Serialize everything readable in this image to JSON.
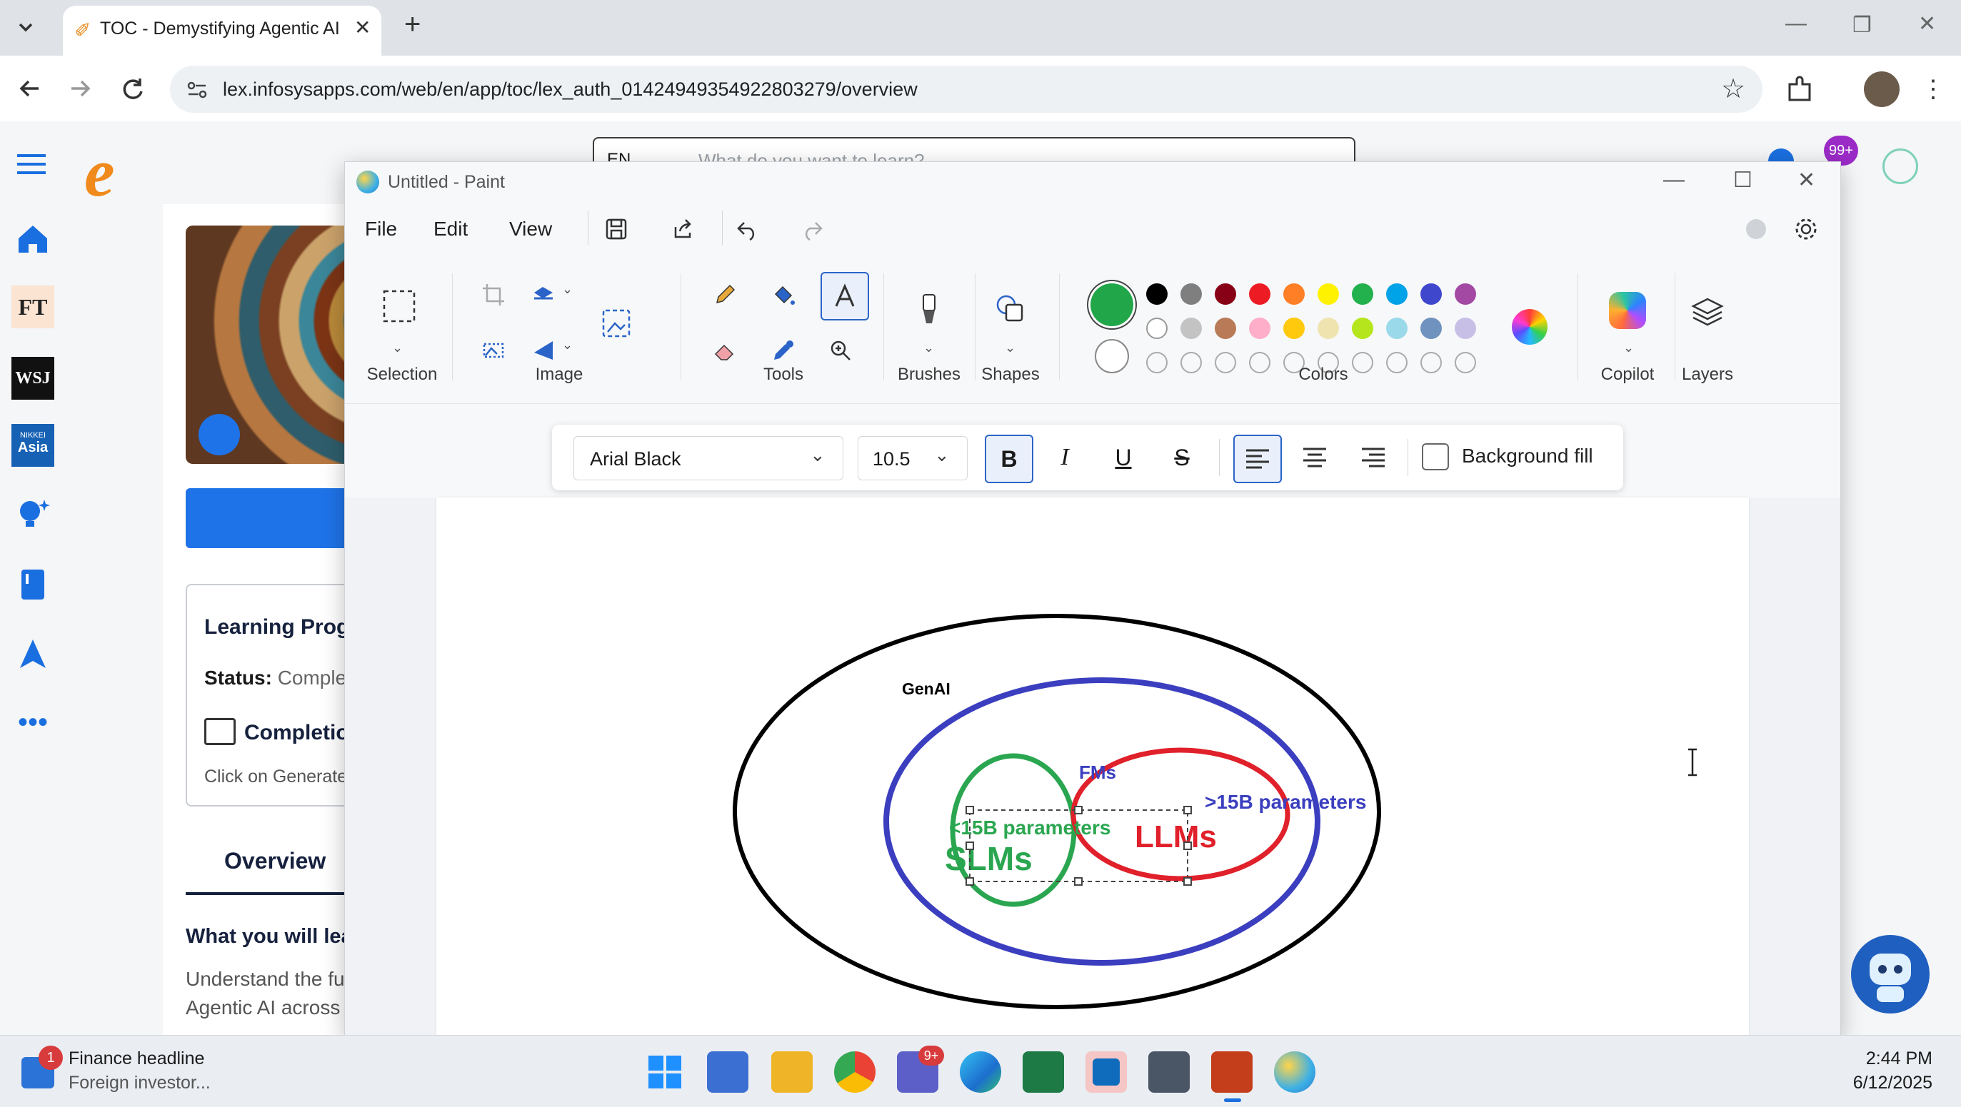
{
  "browser": {
    "tab_title": "TOC - Demystifying Agentic AI",
    "tab_close": "✕",
    "new_tab": "+",
    "url": "lex.infosysapps.com/web/en/app/toc/lex_auth_01424949354922803279/overview",
    "window_controls": {
      "minimize": "—",
      "restore": "❐",
      "close": "✕"
    }
  },
  "site": {
    "logo": "e",
    "search_lang": "EN",
    "search_placeholder": "What do you want to learn?",
    "notif_badge": "99+",
    "nav_labels": {
      "ft": "FT",
      "wsj": "WSJ",
      "nikkei_top": "NIKKEI",
      "nikkei_bottom": "Asia"
    },
    "learning_progress_title": "Learning Progr",
    "status_label": "Status:",
    "status_value": "Comple",
    "completion_label": "Completio",
    "completion_hint": "Click on Generate",
    "overview_tab": "Overview",
    "what_you_learn": "What you will lea",
    "desc_line1": "Understand the fu",
    "desc_line2": "Agentic AI across"
  },
  "paint": {
    "title": "Untitled - Paint",
    "menu": [
      "File",
      "Edit",
      "View"
    ],
    "groups": {
      "selection": "Selection",
      "image": "Image",
      "tools": "Tools",
      "brushes": "Brushes",
      "shapes": "Shapes",
      "colors": "Colors",
      "copilot": "Copilot",
      "layers": "Layers"
    },
    "text_toolbar": {
      "font": "Arial Black",
      "size": "10.5",
      "bold": "B",
      "italic": "I",
      "underline": "U",
      "strikethrough": "S",
      "background_fill": "Background fill"
    },
    "colors": {
      "primary": "#22a64a",
      "secondary": "#ffffff",
      "row1": [
        "#000000",
        "#7f7f7f",
        "#880015",
        "#ed1c24",
        "#ff7f27",
        "#fff200",
        "#22b14c",
        "#00a2e8",
        "#3f48cc",
        "#a349a4"
      ],
      "row2": [
        "#ffffff",
        "#c3c3c3",
        "#b97a57",
        "#ffaec9",
        "#ffc90e",
        "#efe4b0",
        "#b5e61d",
        "#99d9ea",
        "#7092be",
        "#c8bfe7"
      ]
    },
    "diagram": {
      "genai": "GenAI",
      "fms": "FMs",
      "gt15b": ">15B parameters",
      "lt15b": "<15B parameters",
      "slms": "SLMs",
      "llms": "LLMs",
      "colors": {
        "outer": "#000000",
        "fm": "#3b3fbf",
        "slm": "#2aa650",
        "llm": "#e0202a"
      }
    }
  },
  "taskbar": {
    "news_badge": "1",
    "news_title": "Finance headline",
    "news_sub": "Foreign investor...",
    "teams_badge": "9+",
    "time": "2:44 PM",
    "date": "6/12/2025"
  }
}
